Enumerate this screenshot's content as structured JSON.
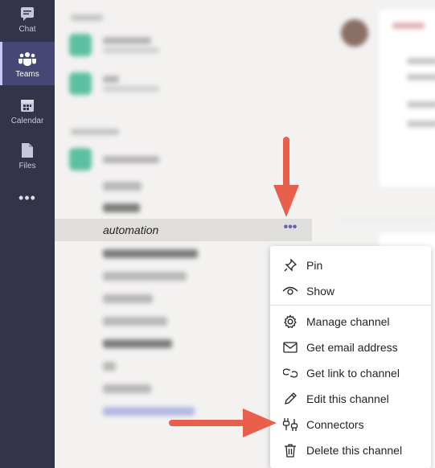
{
  "rail": {
    "items": [
      {
        "label": "Chat",
        "icon": "chat-icon"
      },
      {
        "label": "Teams",
        "icon": "teams-icon",
        "active": true
      },
      {
        "label": "Calendar",
        "icon": "calendar-icon"
      },
      {
        "label": "Files",
        "icon": "files-icon"
      }
    ],
    "more": "•••"
  },
  "channel_list": {
    "selected_channel": "automation",
    "more_options": "•••"
  },
  "context_menu": {
    "items": [
      {
        "label": "Pin",
        "icon": "pin-icon"
      },
      {
        "label": "Show",
        "icon": "eye-icon"
      },
      {
        "label": "Manage channel",
        "icon": "gear-icon"
      },
      {
        "label": "Get email address",
        "icon": "mail-icon"
      },
      {
        "label": "Get link to channel",
        "icon": "link-icon"
      },
      {
        "label": "Edit this channel",
        "icon": "pencil-icon"
      },
      {
        "label": "Connectors",
        "icon": "connector-icon"
      },
      {
        "label": "Delete this channel",
        "icon": "trash-icon"
      }
    ]
  },
  "colors": {
    "rail_bg": "#33344a",
    "accent": "#6264a7",
    "annotation_arrow": "#e8604c"
  }
}
